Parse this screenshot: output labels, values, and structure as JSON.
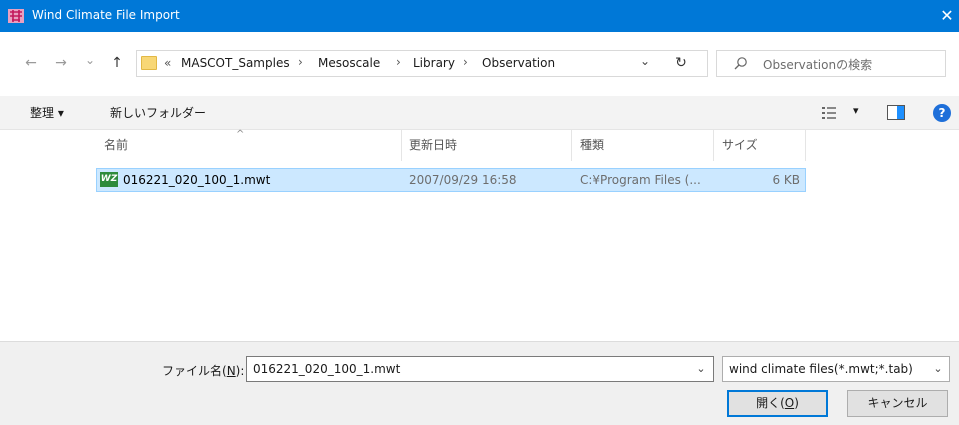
{
  "window": {
    "title": "Wind Climate File Import",
    "close_glyph": "✕"
  },
  "nav": {
    "back": "←",
    "forward": "→",
    "recent": "⌄",
    "up": "↑",
    "refresh": "↻",
    "address_dropdown": "⌄"
  },
  "breadcrumb": {
    "overflow": "«",
    "separator": "›",
    "items": [
      "MASCOT_Samples",
      "Mesoscale",
      "Library",
      "Observation"
    ]
  },
  "search": {
    "placeholder": "Observationの検索"
  },
  "toolbar": {
    "organize": "整理 ▾",
    "new_folder": "新しいフォルダー",
    "view_dropdown": "▾",
    "help": "?"
  },
  "columns": {
    "name": "名前",
    "date": "更新日時",
    "type": "種類",
    "size": "サイズ",
    "sort_indicator": "^"
  },
  "files": [
    {
      "icon": "WZ",
      "name": "016221_020_100_1.mwt",
      "date": "2007/09/29 16:58",
      "type": "C:¥Program Files (...",
      "size": "6 KB"
    }
  ],
  "footer": {
    "filename_label_pre": "ファイル名(",
    "filename_label_key": "N",
    "filename_label_post": "):",
    "filename_value": "016221_020_100_1.mwt",
    "filter_value": "wind climate files(*.mwt;*.tab)",
    "dropdown_glyph": "⌄",
    "open_pre": "開く(",
    "open_key": "O",
    "open_post": ")",
    "cancel": "キャンセル"
  },
  "colors": {
    "accent": "#0078d7",
    "selection": "#cce8ff",
    "selection_border": "#99d1ff",
    "file_icon": "#2e8b3c"
  }
}
